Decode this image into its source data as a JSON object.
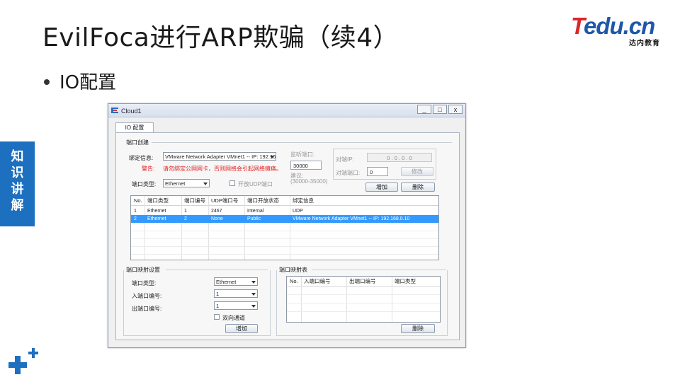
{
  "slide": {
    "title": "EvilFoca进行ARP欺骗（续4）",
    "bullet": "IO配置",
    "side_tab": [
      "知",
      "识",
      "讲",
      "解"
    ],
    "logo": {
      "brand_t": "T",
      "brand_rest": "edu.cn",
      "sub": "达内教育"
    }
  },
  "window": {
    "title": "Cloud1",
    "buttons": {
      "minimize": "_",
      "maximize": "□",
      "close": "x"
    },
    "tab": "IO 配置",
    "port_create": {
      "group_title": "端口创建",
      "bind_label": "绑定信息:",
      "bind_value": "VMware Network Adapter VMnet1 -- IP: 192.16",
      "warning_label": "警告:",
      "warning_text": "请勿绑定公网网卡，否则网络会引起网络瘫痪。",
      "port_type_label": "端口类型:",
      "port_type_value": "Ethernet",
      "open_udp_label": "开放UDP端口",
      "listen_port_label": "监听端口:",
      "listen_port_value": "30000",
      "suggest_label": "建议:",
      "suggest_range": "(30000-35000)",
      "peer_ip_label": "对端IP:",
      "peer_ip_value": "0 . 0 . 0 . 0",
      "peer_port_label": "对端端口:",
      "peer_port_value": "0",
      "modify_button": "修改",
      "add_button": "增加",
      "delete_button": "删除",
      "table": {
        "headers": [
          "No.",
          "端口类型",
          "端口编号",
          "UDP端口号",
          "端口开放状态",
          "绑定信息"
        ],
        "rows": [
          [
            "1",
            "Ethernet",
            "1",
            "2467",
            "Internal",
            "UDP"
          ],
          [
            "2",
            "Ethernet",
            "2",
            "None",
            "Public",
            "VMware Network Adapter VMnet1 -- IP: 192.168.0.10"
          ]
        ],
        "selected_row": 1
      }
    },
    "port_mapping": {
      "group_title": "端口映射设置",
      "port_type_label": "端口类型:",
      "port_type_value": "Ethernet",
      "in_port_label": "入端口编号:",
      "in_port_value": "1",
      "out_port_label": "出端口编号:",
      "out_port_value": "1",
      "bidirectional_label": "双向通道",
      "add_button": "增加"
    },
    "mapping_table": {
      "group_title": "端口映射表",
      "headers": [
        "No.",
        "入端口编号",
        "出端口编号",
        "端口类型"
      ],
      "delete_button": "删除"
    }
  }
}
